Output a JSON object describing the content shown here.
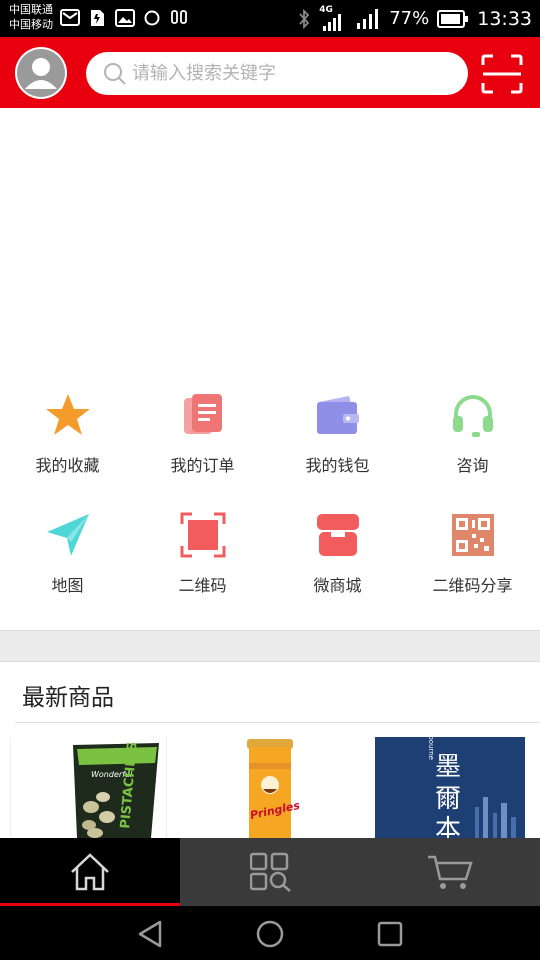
{
  "status_bar": {
    "carrier_1": "中国联通",
    "carrier_2": "中国移动",
    "network": "4G",
    "battery_pct": "77%",
    "time": "13:33"
  },
  "header": {
    "search_placeholder": "请输入搜索关键字",
    "brand_color": "#e8000f"
  },
  "quick_menu": [
    {
      "label": "我的收藏",
      "icon": "star-icon",
      "color": "#f39c2c"
    },
    {
      "label": "我的订单",
      "icon": "order-document-icon",
      "color": "#f07575"
    },
    {
      "label": "我的钱包",
      "icon": "wallet-icon",
      "color": "#8f8fe8"
    },
    {
      "label": "咨询",
      "icon": "headset-icon",
      "color": "#8dd98d"
    },
    {
      "label": "地图",
      "icon": "paper-plane-icon",
      "color": "#4fd6d6"
    },
    {
      "label": "二维码",
      "icon": "scan-frame-icon",
      "color": "#f25c5c"
    },
    {
      "label": "微商城",
      "icon": "shop-icon",
      "color": "#f25c5c"
    },
    {
      "label": "二维码分享",
      "icon": "qr-code-icon",
      "color": "#e0866b"
    }
  ],
  "latest": {
    "title": "最新商品",
    "products": [
      {
        "name": "Wonderful Pistachios",
        "brand_text": "Wonderful",
        "side_text": "PISTACHIOS"
      },
      {
        "name": "Pringles",
        "brand_text": "Pringles"
      },
      {
        "name": "Melbourne travel book",
        "title_text": "墨爾本",
        "brand_text": "Melbourne"
      }
    ]
  },
  "tab_bar": [
    {
      "icon": "home-icon",
      "active": true
    },
    {
      "icon": "category-search-icon",
      "active": false
    },
    {
      "icon": "cart-icon",
      "active": false
    }
  ]
}
